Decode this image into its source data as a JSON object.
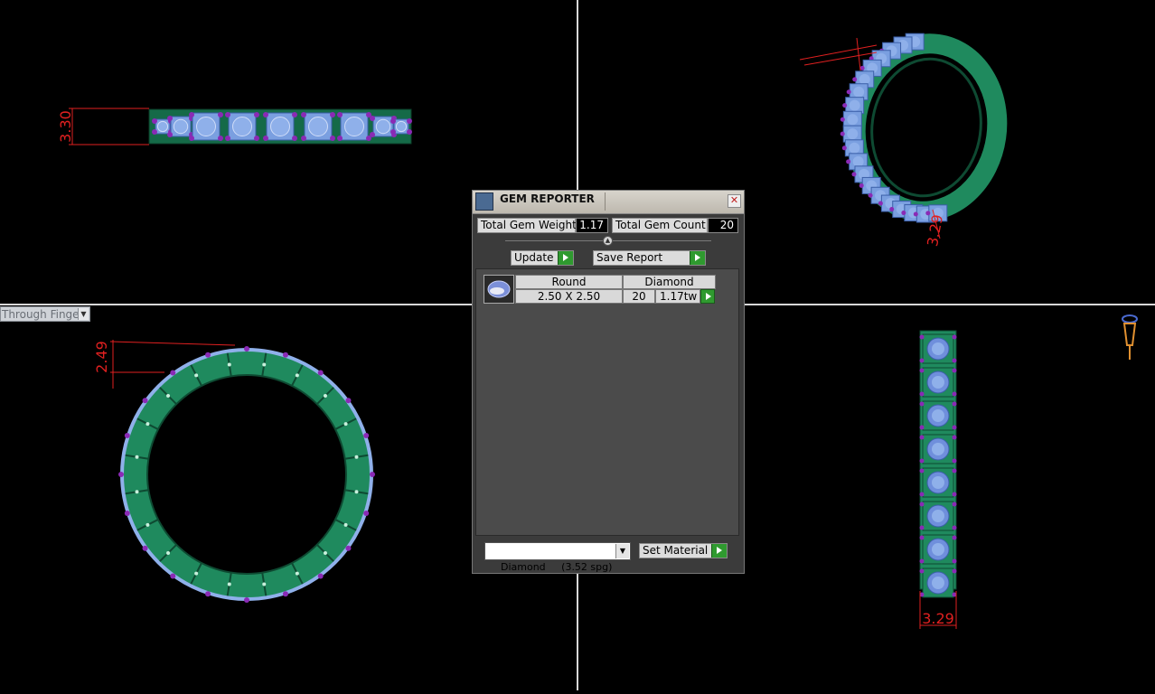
{
  "viewports": {
    "top_view": {
      "dimension_label": "3.30"
    },
    "perspective_view": {
      "dimension_label": "3.29"
    },
    "front_view": {
      "dimension_label": "2.49"
    },
    "side_view": {
      "dimension_label": "3.29"
    }
  },
  "view_selector": {
    "value": "Through Finger"
  },
  "gem_reporter": {
    "title": "GEM REPORTER",
    "total_gem_weight_label": "Total Gem Weight",
    "total_gem_weight_value": "1.17",
    "total_gem_count_label": "Total Gem Count",
    "total_gem_count_value": "20",
    "update_label": "Update",
    "save_report_label": "Save Report",
    "gem_rows": [
      {
        "shape": "Round",
        "material": "Diamond",
        "size": "2.50 X 2.50",
        "count": "20",
        "weight": "1.17tw"
      }
    ],
    "material_select": {
      "value": "Diamond     (3.52 spg)"
    },
    "set_material_label": "Set Material"
  },
  "colors": {
    "metal": "#1f8a5e",
    "gem": "#8fb0ea",
    "prong": "#8a2ab5",
    "dimension": "#e02020",
    "go_button": "#2f9a2f"
  }
}
